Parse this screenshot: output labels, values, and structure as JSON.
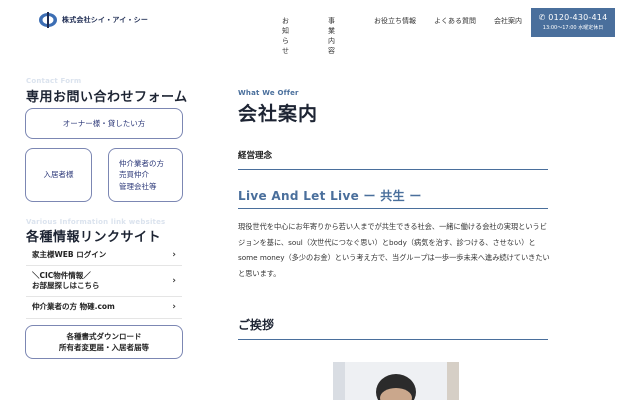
{
  "header": {
    "company_name": "株式会社シイ・アイ・シー",
    "nav": [
      "お知らせ",
      "事業内容",
      "お役立ち情報",
      "よくある質問",
      "会社案内"
    ],
    "phone": "0120-430-414",
    "hours": "13:00～17:00 水曜定休日"
  },
  "sidebar": {
    "contact_en": "Contact Form",
    "contact_title": "専用お問い合わせフォーム",
    "owner_button": "オーナー様・貸したい方",
    "tenant_button": "入居者様",
    "agent_button": [
      "仲介業者の方",
      "売買仲介",
      "管理会社等"
    ],
    "links_en": "Various Information link websites",
    "links_title": "各種情報リンクサイト",
    "links": [
      [
        "家主様WEB ログイン"
      ],
      [
        "＼CIC物件情報／",
        "お部屋探しはこちら"
      ],
      [
        "仲介業者の方 物確.com"
      ]
    ],
    "download_button": [
      "各種書式ダウンロード",
      "所有者変更届・入居者届等"
    ]
  },
  "main": {
    "what_en": "What We Offer",
    "title": "会社案内",
    "philosophy_label": "経営理念",
    "motto": "Live And Let Live ー 共生 ー",
    "body": "現役世代を中心にお年寄りから若い人までが共生できる社会、一緒に働ける会社の実現というビジョンを基に、soul（次世代につなぐ思い）とbody（病気を治す、診つける、させない）とsome money（多少のお金）という考え方で、当グループは一歩一歩未来へ進み続けていきたいと思います。",
    "greeting_title": "ご挨拶"
  },
  "colors": {
    "brand": "#4a6f9c",
    "accent_button_border": "#7c87b3",
    "text": "#1d2433"
  }
}
